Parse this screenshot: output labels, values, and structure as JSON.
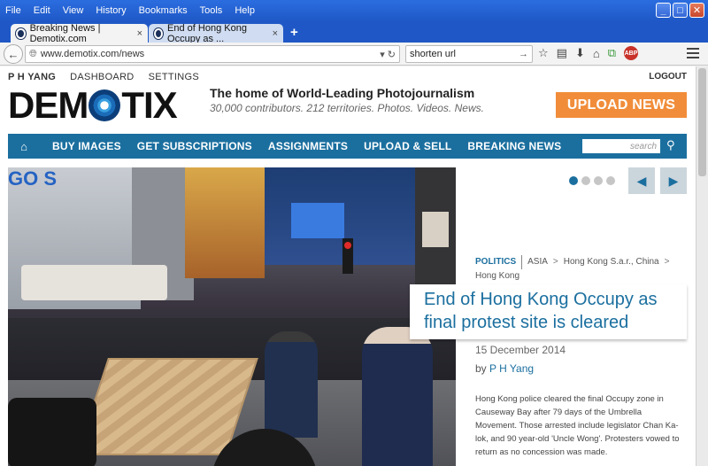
{
  "menubar": {
    "items": [
      "File",
      "Edit",
      "View",
      "History",
      "Bookmarks",
      "Tools",
      "Help"
    ]
  },
  "window_controls": {
    "minimize": "_",
    "maximize": "□",
    "close": "✕"
  },
  "tabs": [
    {
      "label": "Breaking News | Demotix.com",
      "close": "×",
      "active": true
    },
    {
      "label": "End of Hong Kong Occupy as ...",
      "close": "×",
      "active": false
    }
  ],
  "new_tab": "+",
  "navbar": {
    "back": "←",
    "url": "www.demotix.com/news",
    "url_controls": "▾  ↻",
    "search_value": "shorten url",
    "search_go": "→",
    "icons": [
      "star-icon",
      "reader-icon",
      "download-icon",
      "home-icon",
      "sync-icon",
      "adblock-icon"
    ],
    "adblock_label": "ABP",
    "icon_glyphs": {
      "star": "☆",
      "reader": "▤",
      "download": "⬇",
      "home": "⌂",
      "sync": "⧉"
    }
  },
  "site": {
    "user": "P H YANG",
    "dashboard": "DASHBOARD",
    "settings": "SETTINGS",
    "logout": "LOGOUT",
    "logo_left": "DEM",
    "logo_right": "TIX",
    "tagline": "The home of World-Leading Photojournalism",
    "subtagline": "30,000 contributors. 212 territories. Photos. Videos. News.",
    "upload_button": "UPLOAD NEWS",
    "nav": [
      "BUY IMAGES",
      "GET SUBSCRIPTIONS",
      "ASSIGNMENTS",
      "UPLOAD & SELL",
      "BREAKING NEWS"
    ],
    "home_glyph": "⌂",
    "search_placeholder": "search",
    "search_glyph": "⚲"
  },
  "hero": {
    "sign_text": "GO S"
  },
  "slideshow": {
    "dot_count": 4,
    "active_dot": 0,
    "prev": "◀",
    "next": "▶"
  },
  "article": {
    "category": "POLITICS",
    "breadcrumb": [
      "ASIA",
      "Hong Kong S.a.r., China",
      "Hong Kong"
    ],
    "breadcrumb_sep": ">",
    "headline": "End of Hong Kong Occupy as final protest site is cleared",
    "date": "15 December 2014",
    "by": "by",
    "author": "P H Yang",
    "summary": "Hong Kong police cleared the final Occupy zone in Causeway Bay after 79 days of the Umbrella Movement. Those arrested include legislator Chan Ka-lok, and 90 year-old 'Uncle Wong'. Protesters vowed to return as no concession was made."
  }
}
